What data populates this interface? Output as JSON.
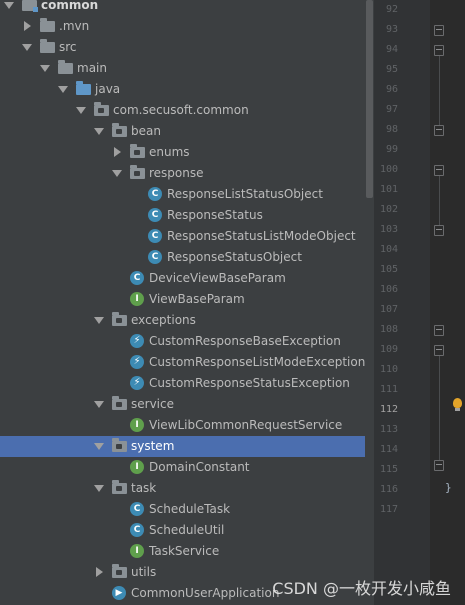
{
  "tree": {
    "nodes": [
      {
        "label": "common",
        "icon": "module-folder-icon",
        "expanded": true,
        "bold": true
      },
      {
        "label": ".mvn",
        "icon": "folder-icon",
        "expanded": false
      },
      {
        "label": "src",
        "icon": "folder-icon",
        "expanded": true
      },
      {
        "label": "main",
        "icon": "folder-icon",
        "expanded": true
      },
      {
        "label": "java",
        "icon": "source-folder-icon",
        "expanded": true
      },
      {
        "label": "com.secusoft.common",
        "icon": "package-icon",
        "expanded": true
      },
      {
        "label": "bean",
        "icon": "package-icon",
        "expanded": true
      },
      {
        "label": "enums",
        "icon": "package-icon",
        "expanded": false
      },
      {
        "label": "response",
        "icon": "package-icon",
        "expanded": true
      },
      {
        "label": "ResponseListStatusObject",
        "icon": "class-icon"
      },
      {
        "label": "ResponseStatus",
        "icon": "class-icon"
      },
      {
        "label": "ResponseStatusListModeObject",
        "icon": "class-icon"
      },
      {
        "label": "ResponseStatusObject",
        "icon": "class-icon"
      },
      {
        "label": "DeviceViewBaseParam",
        "icon": "class-icon"
      },
      {
        "label": "ViewBaseParam",
        "icon": "interface-icon"
      },
      {
        "label": "exceptions",
        "icon": "package-icon",
        "expanded": true
      },
      {
        "label": "CustomResponseBaseException",
        "icon": "exception-class-icon"
      },
      {
        "label": "CustomResponseListModeException",
        "icon": "exception-class-icon"
      },
      {
        "label": "CustomResponseStatusException",
        "icon": "exception-class-icon"
      },
      {
        "label": "service",
        "icon": "package-icon",
        "expanded": true
      },
      {
        "label": "ViewLibCommonRequestService",
        "icon": "interface-icon"
      },
      {
        "label": "system",
        "icon": "package-icon",
        "expanded": true,
        "selected": true
      },
      {
        "label": "DomainConstant",
        "icon": "interface-icon"
      },
      {
        "label": "task",
        "icon": "package-icon",
        "expanded": true
      },
      {
        "label": "ScheduleTask",
        "icon": "class-icon"
      },
      {
        "label": "ScheduleUtil",
        "icon": "class-icon"
      },
      {
        "label": "TaskService",
        "icon": "interface-icon"
      },
      {
        "label": "utils",
        "icon": "package-icon",
        "expanded": false
      },
      {
        "label": "CommonUserApplication",
        "icon": "spring-boot-app-icon"
      }
    ]
  },
  "gutter": {
    "line_numbers": [
      "92",
      "93",
      "94",
      "95",
      "96",
      "97",
      "98",
      "99",
      "100",
      "101",
      "102",
      "103",
      "104",
      "105",
      "106",
      "107",
      "108",
      "109",
      "110",
      "111",
      "112",
      "113",
      "114",
      "115",
      "116",
      "117"
    ],
    "current_line": "112"
  },
  "editor": {
    "visible_code": "}"
  },
  "watermark": "CSDN @一枚开发小咸鱼",
  "colors": {
    "panel_bg": "#3c3f41",
    "selection": "#4b6eaf",
    "gutter_bg": "#313335",
    "editor_bg": "#2b2b2b",
    "class_badge": "#3d8bb4",
    "interface_badge": "#5f9f4c",
    "bulb": "#e3a42a"
  }
}
